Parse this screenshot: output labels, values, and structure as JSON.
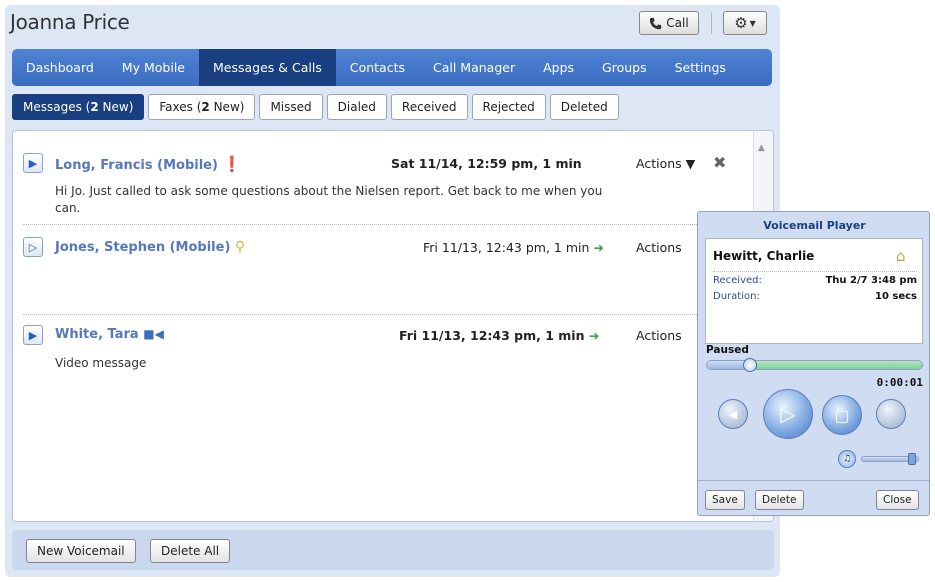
{
  "header": {
    "title": "Joanna Price",
    "call_label": "Call"
  },
  "nav": {
    "items": [
      {
        "label": "Dashboard",
        "active": false
      },
      {
        "label": "My Mobile",
        "active": false
      },
      {
        "label": "Messages & Calls",
        "active": true
      },
      {
        "label": "Contacts",
        "active": false
      },
      {
        "label": "Call Manager",
        "active": false
      },
      {
        "label": "Apps",
        "active": false
      },
      {
        "label": "Groups",
        "active": false
      },
      {
        "label": "Settings",
        "active": false
      }
    ]
  },
  "subtabs": {
    "messages": {
      "pre": "Messages (",
      "count": "2",
      "post": " New)"
    },
    "faxes": {
      "pre": "Faxes (",
      "count": "2",
      "post": " New)"
    },
    "missed": "Missed",
    "dialed": "Dialed",
    "received": "Received",
    "rejected": "Rejected",
    "deleted": "Deleted"
  },
  "messages": [
    {
      "name": "Long, Francis (Mobile)",
      "date": "Sat 11/14, 12:59 pm, 1 min",
      "actions": "Actions",
      "body": "Hi Jo.  Just called to ask some questions about the Nielsen report. Get back to me when you can."
    },
    {
      "name": "Jones, Stephen (Mobile)",
      "date": "Fri 11/13, 12:43 pm, 1 min",
      "actions": "Actions",
      "body": ""
    },
    {
      "name": "White, Tara",
      "date": "Fri 11/13, 12:43 pm, 1 min",
      "actions": "Actions",
      "body": "Video message"
    }
  ],
  "footer": {
    "new_voicemail": "New Voicemail",
    "delete_all": "Delete All"
  },
  "player": {
    "title": "Voicemail Player",
    "caller": "Hewitt, Charlie",
    "received_label": "Received:",
    "received_value": "Thu 2/7  3:48 pm",
    "duration_label": "Duration:",
    "duration_value": "10 secs",
    "status": "Paused",
    "progress": 0.2,
    "time": "0:00:01",
    "volume": 0.9,
    "save": "Save",
    "delete": "Delete",
    "close": "Close"
  },
  "colors": {
    "nav": "#3b6cc0",
    "nav_active": "#1a3f80",
    "link": "#5578b8",
    "panel": "#dce6f4"
  }
}
